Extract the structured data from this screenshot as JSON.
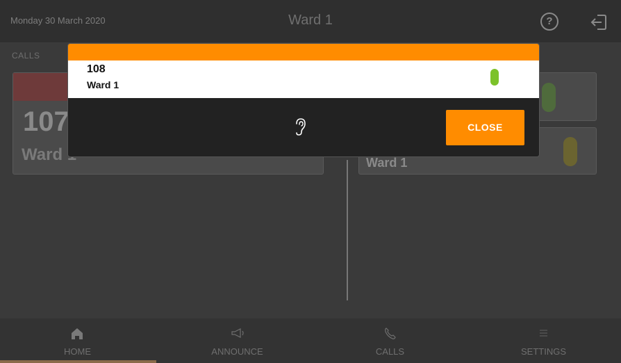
{
  "header": {
    "date": "Monday 30 March 2020",
    "title": "Ward 1",
    "help_icon": "help-circle-icon",
    "logout_icon": "logout-icon"
  },
  "calls_section": {
    "label": "CALLS",
    "card": {
      "number": "107",
      "ward": "Ward 1"
    }
  },
  "right_section": {
    "cards": [
      {
        "ward": "",
        "status_color": "#4f6b3c"
      },
      {
        "ward": "Ward 1",
        "status_color": "#6b6430"
      }
    ]
  },
  "modal": {
    "number": "108",
    "ward": "Ward 1",
    "status_color": "#7cc22a",
    "accent_color": "#ff8c00",
    "listen_icon": "ear-icon",
    "close_label": "CLOSE"
  },
  "bottom_nav": {
    "items": [
      {
        "label": "HOME",
        "icon": "home-icon"
      },
      {
        "label": "ANNOUNCE",
        "icon": "megaphone-icon"
      },
      {
        "label": "CALLS",
        "icon": "phone-icon"
      },
      {
        "label": "SETTINGS",
        "icon": "menu-icon"
      }
    ]
  }
}
